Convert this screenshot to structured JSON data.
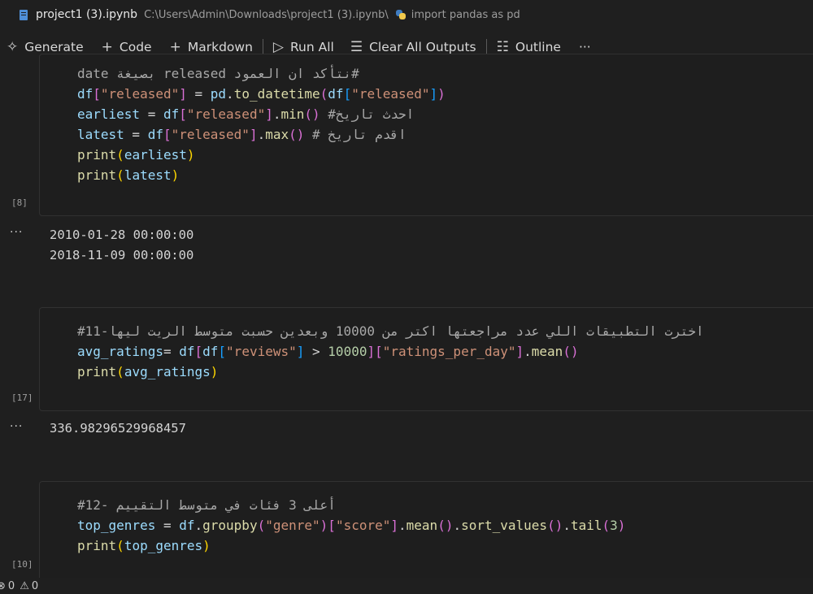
{
  "titlebar": {
    "file_name": "project1 (3).ipynb",
    "path": "C:\\Users\\Admin\\Downloads\\project1 (3).ipynb\\",
    "breadcrumb": "import pandas as pd"
  },
  "toolbar": {
    "generate": "Generate",
    "code": "Code",
    "markdown": "Markdown",
    "run_all": "Run All",
    "clear_outputs": "Clear All Outputs",
    "outline": "Outline",
    "more": "···"
  },
  "cells": [
    {
      "exec_count": "[8]",
      "lines": [
        {
          "comment": "#نتأكد ان العمود released بصيغة date"
        },
        {
          "t1": "df",
          "t2": "[",
          "t3": "\"released\"",
          "t4": "]",
          "t5": " = ",
          "t6": "pd",
          "t7": ".",
          "t8": "to_datetime",
          "t9": "(",
          "t10": "df",
          "t11": "[",
          "t12": "\"released\"",
          "t13": "]",
          "t14": ")"
        },
        {
          "t1": "earliest",
          "t2": " = ",
          "t3": "df",
          "t4": "[",
          "t5": "\"released\"",
          "t6": "]",
          "t7": ".",
          "t8": "min",
          "t9": "()",
          "t10": " #احدث تاريخ"
        },
        {
          "t1": "latest",
          "t2": " = ",
          "t3": "df",
          "t4": "[",
          "t5": "\"released\"",
          "t6": "]",
          "t7": ".",
          "t8": "max",
          "t9": "()",
          "t10": " # اقدم تاريخ"
        },
        {
          "t1": "print",
          "t2": "(",
          "t3": "earliest",
          "t4": ")"
        },
        {
          "t1": "print",
          "t2": "(",
          "t3": "latest",
          "t4": ")"
        }
      ],
      "output": [
        "2010-01-28 00:00:00",
        "2018-11-09 00:00:00"
      ]
    },
    {
      "exec_count": "[17]",
      "lines": [
        {
          "comment": "#11-اخترت التطبيقات اللي عدد مراجعتها اكتر من 10000 وبعدين حسبت متوسط الريت ليها"
        },
        {
          "t1": "avg_ratings",
          "t2": "= ",
          "t3": "df",
          "t4": "[",
          "t5": "df",
          "t6": "[",
          "t7": "\"reviews\"",
          "t8": "]",
          "t9": " > ",
          "t10": "10000",
          "t11": "][",
          "t12": "\"ratings_per_day\"",
          "t13": "]",
          "t14": ".",
          "t15": "mean",
          "t16": "()"
        },
        {
          "t1": "print",
          "t2": "(",
          "t3": "avg_ratings",
          "t4": ")"
        }
      ],
      "output": [
        "336.98296529968457"
      ]
    },
    {
      "exec_count": "[10]",
      "lines": [
        {
          "comment": "#12- أعلى 3 فئات في متوسط التقييم"
        },
        {
          "t1": "top_genres",
          "t2": " = ",
          "t3": "df",
          "t4": ".",
          "t5": "groupby",
          "t6": "(",
          "t7": "\"genre\"",
          "t8": ")",
          "t9": "[",
          "t10": "\"score\"",
          "t11": "]",
          "t12": ".",
          "t13": "mean",
          "t14": "()",
          "t15": ".",
          "t16": "sort_values",
          "t17": "()",
          "t18": ".",
          "t19": "tail",
          "t20": "(",
          "t21": "3",
          "t22": ")"
        },
        {
          "t1": "print",
          "t2": "(",
          "t3": "top_genres",
          "t4": ")"
        }
      ]
    }
  ],
  "output_more": "···",
  "status": {
    "errors": "0",
    "warnings": "0"
  }
}
